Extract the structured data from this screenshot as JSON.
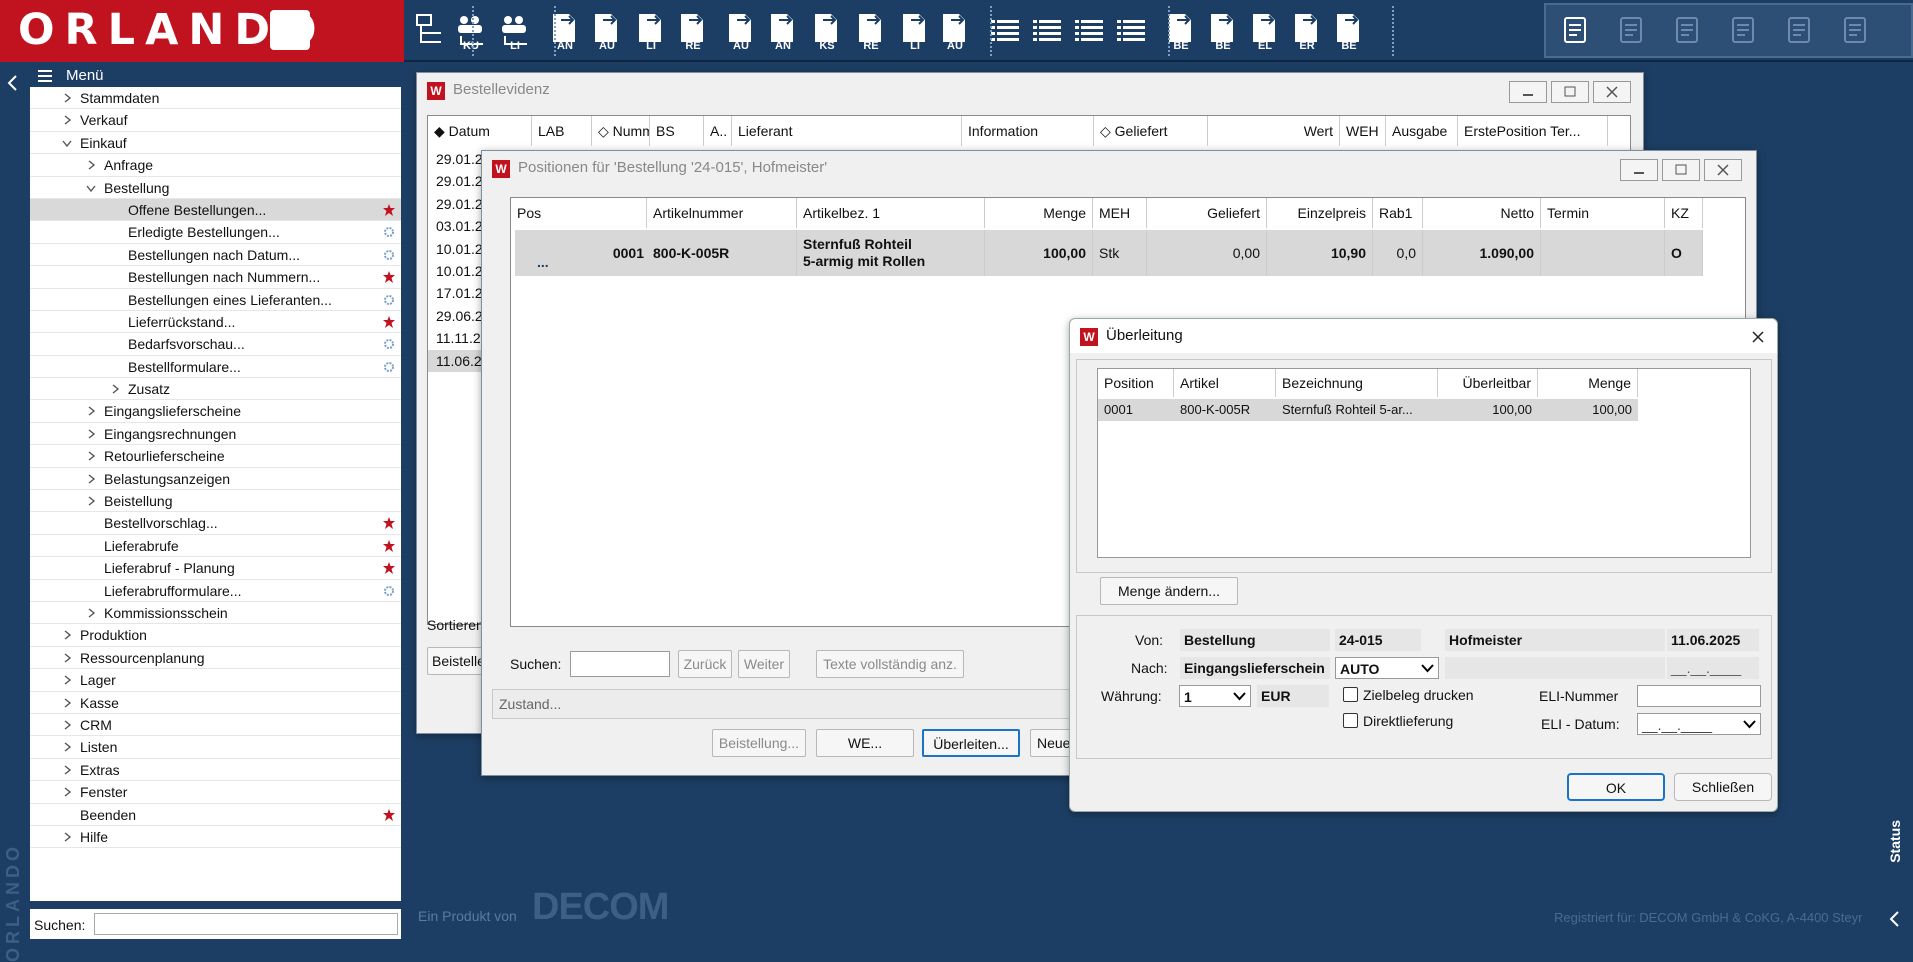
{
  "brand": {
    "logo_text": "ORLANDO"
  },
  "toolbar": {
    "buttons": [
      {
        "icon": "stack-icon",
        "label": ""
      },
      {
        "icon": "people-ku-icon",
        "label": "KU"
      },
      {
        "icon": "people-li-icon",
        "label": "LI"
      },
      {
        "icon": "doc-an-icon",
        "label": "AN"
      },
      {
        "icon": "doc-au-icon",
        "label": "AU"
      },
      {
        "icon": "doc-li-icon",
        "label": "LI"
      },
      {
        "icon": "doc-re-icon",
        "label": "RE"
      },
      {
        "icon": "doc-au2-icon",
        "label": "AU"
      },
      {
        "icon": "doc-an2-icon",
        "label": "AN"
      },
      {
        "icon": "doc-ks-icon",
        "label": "KS"
      },
      {
        "icon": "doc-re2-icon",
        "label": "RE"
      },
      {
        "icon": "doc-li2-icon",
        "label": "LI"
      },
      {
        "icon": "doc-au3-icon",
        "label": "AU"
      },
      {
        "icon": "list-icon",
        "label": ""
      },
      {
        "icon": "list-icon",
        "label": ""
      },
      {
        "icon": "list-icon",
        "label": ""
      },
      {
        "icon": "list-icon",
        "label": ""
      },
      {
        "icon": "doc-be7-icon",
        "label": "BE"
      },
      {
        "icon": "doc-be-icon",
        "label": "BE"
      },
      {
        "icon": "doc-el-icon",
        "label": "EL"
      },
      {
        "icon": "doc-er-icon",
        "label": "ER"
      },
      {
        "icon": "doc-be2-icon",
        "label": "BE"
      }
    ],
    "right": [
      "help-icon",
      "calculator-icon",
      "copy-icon",
      "scissors-icon",
      "clipboard-icon",
      "printer-icon"
    ]
  },
  "menu": {
    "title": "Menü",
    "items": [
      {
        "label": "Stammdaten",
        "level": 1,
        "chev": "right",
        "mark": ""
      },
      {
        "label": "Verkauf",
        "level": 1,
        "chev": "right",
        "mark": ""
      },
      {
        "label": "Einkauf",
        "level": 1,
        "chev": "down",
        "mark": ""
      },
      {
        "label": "Anfrage",
        "level": 2,
        "chev": "right",
        "mark": ""
      },
      {
        "label": "Bestellung",
        "level": 2,
        "chev": "down",
        "mark": ""
      },
      {
        "label": "Offene Bestellungen...",
        "level": 3,
        "chev": "",
        "mark": "star",
        "selected": true
      },
      {
        "label": "Erledigte Bestellungen...",
        "level": 3,
        "chev": "",
        "mark": "gear"
      },
      {
        "label": "Bestellungen nach Datum...",
        "level": 3,
        "chev": "",
        "mark": "gear"
      },
      {
        "label": "Bestellungen nach Nummern...",
        "level": 3,
        "chev": "",
        "mark": "star"
      },
      {
        "label": "Bestellungen eines Lieferanten...",
        "level": 3,
        "chev": "",
        "mark": "gear"
      },
      {
        "label": "Lieferrückstand...",
        "level": 3,
        "chev": "",
        "mark": "star"
      },
      {
        "label": "Bedarfsvorschau...",
        "level": 3,
        "chev": "",
        "mark": "gear"
      },
      {
        "label": "Bestellformulare...",
        "level": 3,
        "chev": "",
        "mark": "gear"
      },
      {
        "label": "Zusatz",
        "level": 3,
        "chev": "right",
        "mark": ""
      },
      {
        "label": "Eingangslieferscheine",
        "level": 2,
        "chev": "right",
        "mark": ""
      },
      {
        "label": "Eingangsrechnungen",
        "level": 2,
        "chev": "right",
        "mark": ""
      },
      {
        "label": "Retourlieferscheine",
        "level": 2,
        "chev": "right",
        "mark": ""
      },
      {
        "label": "Belastungsanzeigen",
        "level": 2,
        "chev": "right",
        "mark": ""
      },
      {
        "label": "Beistellung",
        "level": 2,
        "chev": "right",
        "mark": ""
      },
      {
        "label": "Bestellvorschlag...",
        "level": 2,
        "chev": "",
        "mark": "star"
      },
      {
        "label": "Lieferabrufe",
        "level": 2,
        "chev": "",
        "mark": "star"
      },
      {
        "label": "Lieferabruf - Planung",
        "level": 2,
        "chev": "",
        "mark": "star"
      },
      {
        "label": "Lieferabrufformulare...",
        "level": 2,
        "chev": "",
        "mark": "gear"
      },
      {
        "label": "Kommissionsschein",
        "level": 2,
        "chev": "right",
        "mark": ""
      },
      {
        "label": "Produktion",
        "level": 1,
        "chev": "right",
        "mark": ""
      },
      {
        "label": "Ressourcenplanung",
        "level": 1,
        "chev": "right",
        "mark": ""
      },
      {
        "label": "Lager",
        "level": 1,
        "chev": "right",
        "mark": ""
      },
      {
        "label": "Kasse",
        "level": 1,
        "chev": "right",
        "mark": ""
      },
      {
        "label": "CRM",
        "level": 1,
        "chev": "right",
        "mark": ""
      },
      {
        "label": "Listen",
        "level": 1,
        "chev": "right",
        "mark": ""
      },
      {
        "label": "Extras",
        "level": 1,
        "chev": "right",
        "mark": ""
      },
      {
        "label": "Fenster",
        "level": 1,
        "chev": "right",
        "mark": ""
      },
      {
        "label": "Beenden",
        "level": 1,
        "chev": "",
        "mark": "star"
      },
      {
        "label": "Hilfe",
        "level": 1,
        "chev": "right",
        "mark": ""
      }
    ],
    "search_label": "Suchen:"
  },
  "bestellevidenz": {
    "title": "Bestellevidenz",
    "columns": [
      "Datum",
      "LAB",
      "Nummer",
      "BS",
      "A..",
      "Lieferant",
      "Information",
      "Geliefert",
      "Wert",
      "WEH",
      "Ausgabe",
      "ErstePosition Ter..."
    ],
    "dates": [
      "29.01.2",
      "29.01.2",
      "29.01.2",
      "03.01.2",
      "10.01.2",
      "10.01.2",
      "17.01.2",
      "29.06.2",
      "11.11.2",
      "11.06.2"
    ],
    "sort_label": "Sortieren",
    "bottom_btn": "Beistelle"
  },
  "positionen": {
    "title": "Positionen für 'Bestellung '24-015', Hofmeister'",
    "columns": [
      "Pos",
      "Artikelnummer",
      "Artikelbez. 1",
      "Menge",
      "MEH",
      "Geliefert",
      "Einzelpreis",
      "Rab1",
      "Netto",
      "Termin",
      "KZ"
    ],
    "row": {
      "pos": "0001",
      "artnr": "800-K-005R",
      "bez1": "Sternfuß Rohteil",
      "bez2": "5-armig mit Rollen",
      "menge": "100,00",
      "meh": "Stk",
      "geliefert": "0,00",
      "preis": "10,90",
      "rab": "0,0",
      "netto": "1.090,00",
      "termin": "",
      "kz": "O"
    },
    "more": "...",
    "search_label": "Suchen:",
    "zurueck": "Zurück",
    "weiter": "Weiter",
    "texte": "Texte vollständig anz.",
    "zustand": "Zustand...",
    "btn_beistellung": "Beistellung...",
    "btn_we": "WE...",
    "btn_ueberleiten": "Überleiten...",
    "btn_neue": "Neue"
  },
  "ueberleitung": {
    "title": "Überleitung",
    "columns": [
      "Position",
      "Artikel",
      "Bezeichnung",
      "Überleitbar",
      "Menge"
    ],
    "row": {
      "position": "0001",
      "artikel": "800-K-005R",
      "bez": "Sternfuß Rohteil 5-ar...",
      "ueberleitbar": "100,00",
      "menge": "100,00"
    },
    "menge_btn": "Menge ändern...",
    "von_label": "Von:",
    "von_typ": "Bestellung",
    "von_nr": "24-015",
    "von_name": "Hofmeister",
    "von_datum": "11.06.2025",
    "nach_label": "Nach:",
    "nach_typ": "Eingangslieferschein",
    "nach_select": "AUTO",
    "nach_datum": "__.__.____",
    "waehrung_label": "Währung:",
    "waehrung_val": "1",
    "waehrung_cur": "EUR",
    "zielbeleg": "Zielbeleg drucken",
    "direkt": "Direktlieferung",
    "eli_nr_label": "ELI-Nummer",
    "eli_datum_label": "ELI - Datum:",
    "eli_datum_val": "__.__.____",
    "ok": "OK",
    "close": "Schließen"
  },
  "footer": {
    "product": "Ein Produkt von",
    "product_logo": "DECOM",
    "registered": "Registriert für: DECOM GmbH & CoKG, A-4400 Steyr",
    "status": "Status"
  },
  "colors": {
    "brand_red": "#c1121f",
    "navy": "#1d3e64",
    "star_red": "#c1121f",
    "gear_blue": "#7b9cc4"
  }
}
